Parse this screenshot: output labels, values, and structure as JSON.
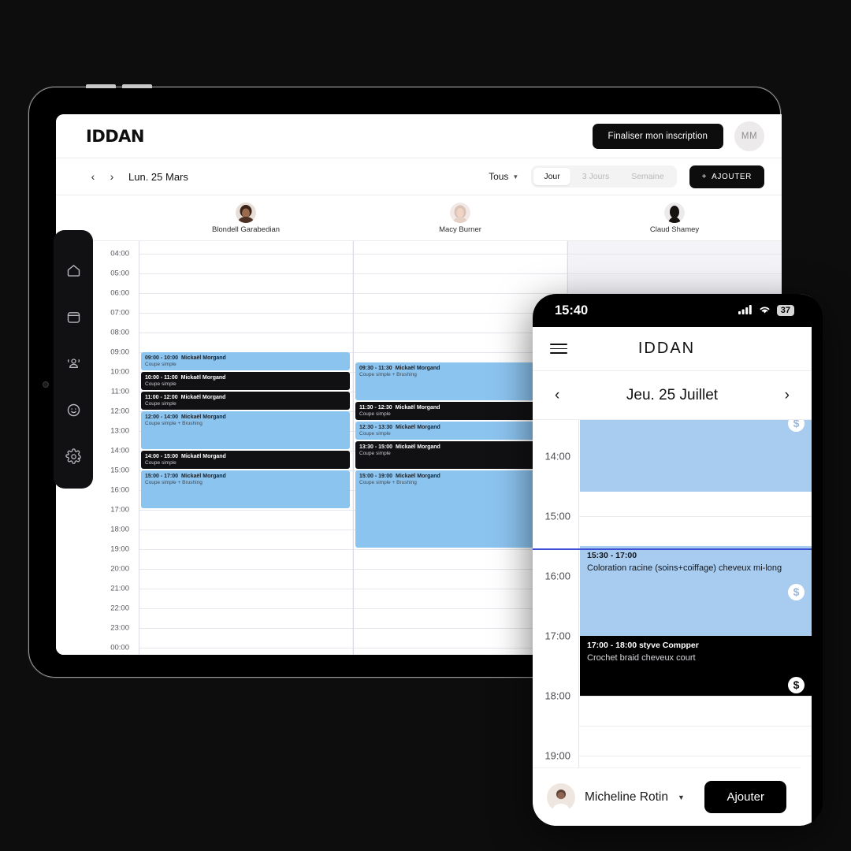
{
  "tablet": {
    "topbar": {
      "logo": "IDDAN",
      "cta_label": "Finaliser mon inscription",
      "avatar_initials": "MM"
    },
    "toolbar": {
      "prev_icon": "chevron-left-icon",
      "next_icon": "chevron-right-icon",
      "date": "Lun. 25 Mars",
      "filter_label": "Tous",
      "views": [
        {
          "label": "Jour",
          "active": true
        },
        {
          "label": "3 Jours",
          "active": false
        },
        {
          "label": "Semaine",
          "active": false
        }
      ],
      "add_label": "AJOUTER",
      "add_plus": "+"
    },
    "staff": [
      {
        "name": "Blondell Garabedian"
      },
      {
        "name": "Macy Burner"
      },
      {
        "name": "Claud Shamey"
      }
    ],
    "time_labels": [
      "04:00",
      "05:00",
      "06:00",
      "07:00",
      "08:00",
      "09:00",
      "10:00",
      "11:00",
      "12:00",
      "13:00",
      "14:00",
      "15:00",
      "16:00",
      "17:00",
      "18:00",
      "19:00",
      "20:00",
      "21:00",
      "22:00",
      "23:00",
      "00:00"
    ],
    "appointments_col1": [
      {
        "time": "09:00 - 10:00",
        "client": "Mickaël Morgand",
        "service": "Coupe simple",
        "start": 9,
        "end": 10,
        "style": "blue"
      },
      {
        "time": "10:00 - 11:00",
        "client": "Mickaël Morgand",
        "service": "Coupe simple",
        "start": 10,
        "end": 11,
        "style": "dark"
      },
      {
        "time": "11:00 - 12:00",
        "client": "Mickaël Morgand",
        "service": "Coupe simple",
        "start": 11,
        "end": 12,
        "style": "dark"
      },
      {
        "time": "12:00 - 14:00",
        "client": "Mickaël Morgand",
        "service": "Coupe simple + Brushing",
        "start": 12,
        "end": 14,
        "style": "blue"
      },
      {
        "time": "14:00 - 15:00",
        "client": "Mickaël Morgand",
        "service": "Coupe simple",
        "start": 14,
        "end": 15,
        "style": "dark"
      },
      {
        "time": "15:00 - 17:00",
        "client": "Mickaël Morgand",
        "service": "Coupe simple + Brushing",
        "start": 15,
        "end": 17,
        "style": "blue"
      }
    ],
    "appointments_col2": [
      {
        "time": "09:30 - 11:30",
        "client": "Mickaël Morgand",
        "service": "Coupe simple + Brushing",
        "start": 9.5,
        "end": 11.5,
        "style": "blue"
      },
      {
        "time": "11:30 - 12:30",
        "client": "Mickaël Morgand",
        "service": "Coupe simple",
        "start": 11.5,
        "end": 12.5,
        "style": "dark"
      },
      {
        "time": "12:30 - 13:30",
        "client": "Mickaël Morgand",
        "service": "Coupe simple",
        "start": 12.5,
        "end": 13.5,
        "style": "blue"
      },
      {
        "time": "13:30 - 15:00",
        "client": "Mickaël Morgand",
        "service": "Coupe simple",
        "start": 13.5,
        "end": 15,
        "style": "dark"
      },
      {
        "time": "15:00 - 19:00",
        "client": "Mickaël Morgand",
        "service": "Coupe simple + Brushing",
        "start": 15,
        "end": 19,
        "style": "blue"
      }
    ],
    "sidebar": [
      {
        "icon": "home-icon",
        "name": "sidebar-item-home"
      },
      {
        "icon": "calendar-icon",
        "name": "sidebar-item-calendar"
      },
      {
        "icon": "users-icon",
        "name": "sidebar-item-clients"
      },
      {
        "icon": "smiley-icon",
        "name": "sidebar-item-feedback"
      },
      {
        "icon": "gear-icon",
        "name": "sidebar-item-settings"
      }
    ]
  },
  "phone": {
    "status": {
      "time": "15:40",
      "signal_icon": "cellular-signal-icon",
      "wifi_icon": "wifi-icon",
      "battery": "37"
    },
    "header": {
      "menu_icon": "hamburger-menu-icon",
      "logo": "IDDAN"
    },
    "datebar": {
      "prev": "‹",
      "date": "Jeu. 25 Juillet",
      "next": "›"
    },
    "time_labels": [
      "14:00",
      "15:00",
      "16:00",
      "17:00",
      "18:00",
      "19:00"
    ],
    "appointments": [
      {
        "time": "",
        "client": "",
        "service": "",
        "start": 13.2,
        "end": 14.6,
        "style": "blue",
        "badge": "$"
      },
      {
        "time": "15:30 - 17:00",
        "client": "",
        "service": "Coloration racine (soins+coiffage) cheveux mi-long",
        "start": 15.5,
        "end": 17.0,
        "style": "blue",
        "badge": "$"
      },
      {
        "time": "17:00 - 18:00",
        "client": "styve Compper",
        "service": "Crochet braid cheveux court",
        "start": 17.0,
        "end": 18.0,
        "style": "dark",
        "badge": "$"
      }
    ],
    "now_time": 15.55,
    "bottom": {
      "user_name": "Micheline Rotin",
      "user_chevron": "chevron-down-icon",
      "add_label": "Ajouter"
    }
  },
  "colors": {
    "accent_blue_tablet": "#8cc4f0",
    "accent_blue_phone": "#a8cbf0",
    "dark": "#111114",
    "now_line": "#3d4fd6",
    "background": "#0d0d0d"
  }
}
